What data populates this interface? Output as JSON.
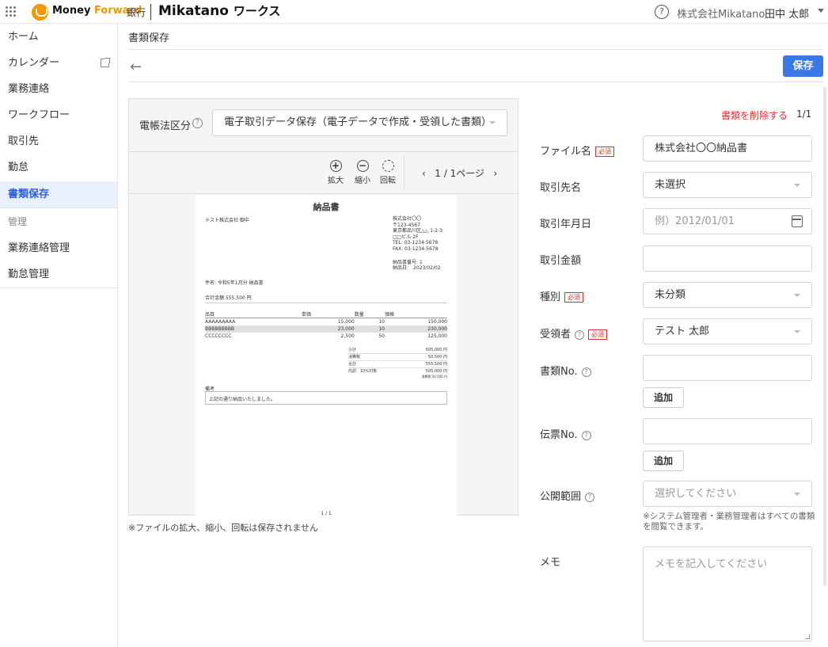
{
  "header": {
    "brand_money": "Money ",
    "brand_forward": "Forward",
    "brand_bank": "銀行",
    "app_name": "Mikatano",
    "app_suffix": "ワークス",
    "company": "株式会社Mikatano",
    "user": "田中 太郎"
  },
  "sidebar": {
    "items": [
      "ホーム",
      "カレンダー",
      "業務連絡",
      "ワークフロー",
      "取引先",
      "勤怠",
      "書類保存"
    ],
    "section": "管理",
    "admin_items": [
      "業務連絡管理",
      "勤怠管理"
    ],
    "active": "書類保存"
  },
  "page": {
    "title": "書類保存",
    "save": "保存"
  },
  "viewer": {
    "law_label": "電帳法区分",
    "law_value": "電子取引データ保存（電子データで作成・受領した書類）",
    "zoom_in": "拡大",
    "zoom_out": "縮小",
    "rotate": "回転",
    "page_indicator": "1 / 1ページ",
    "note": "※ファイルの拡大、縮小、回転は保存されません"
  },
  "document": {
    "title": "納品書",
    "to": "テスト株式会社 御中",
    "from": [
      "株式会社〇〇",
      "〒123-4567",
      "東京都品川区△△ 1-2-3",
      "□□ビル 2F",
      "TEL: 03-1234-5678",
      "FAX: 03-1234-5678"
    ],
    "info": [
      "納品書番号: 1",
      "納品日:　2023/02/02"
    ],
    "subject": "件名: 令和5年1月分 納品書",
    "total": "合計金額 555,500 円",
    "headers": [
      "品目",
      "単価",
      "数量",
      "価格"
    ],
    "rows": [
      [
        "AAAAAAAAA",
        "15,000",
        "10",
        "150,000"
      ],
      [
        "BBBBBBBBB",
        "23,000",
        "10",
        "230,000"
      ],
      [
        "CCCCCCCC",
        "2,500",
        "50",
        "125,000"
      ]
    ],
    "summary": [
      [
        "小計",
        "505,000 円"
      ],
      [
        "消費税",
        "50,500 円"
      ],
      [
        "合計",
        "555,500 円"
      ],
      [
        "内訳　10%対象",
        "505,000 円"
      ]
    ],
    "summary_sub": "消費税 50,500 円",
    "remark_label": "備考",
    "remark": "上記の通り納品いたしました。",
    "page": "1 / 1"
  },
  "form": {
    "delete": "書類を削除する",
    "count": "1/1",
    "required": "必須",
    "file_name_label": "ファイル名",
    "file_name": "株式会社〇〇納品書",
    "partner_label": "取引先名",
    "partner": "未選択",
    "date_label": "取引年月日",
    "date_placeholder": "例）2012/01/01",
    "amount_label": "取引金額",
    "amount": "",
    "type_label": "種別",
    "type": "未分類",
    "receiver_label": "受領者",
    "receiver": "テスト 太郎",
    "doc_no_label": "書類No.",
    "add": "追加",
    "slip_no_label": "伝票No.",
    "scope_label": "公開範囲",
    "scope_placeholder": "選択してください",
    "scope_hint": "※システム管理者・業務管理者はすべての書類を閲覧できます。",
    "memo_label": "メモ",
    "memo_placeholder": "メモを記入してください"
  }
}
